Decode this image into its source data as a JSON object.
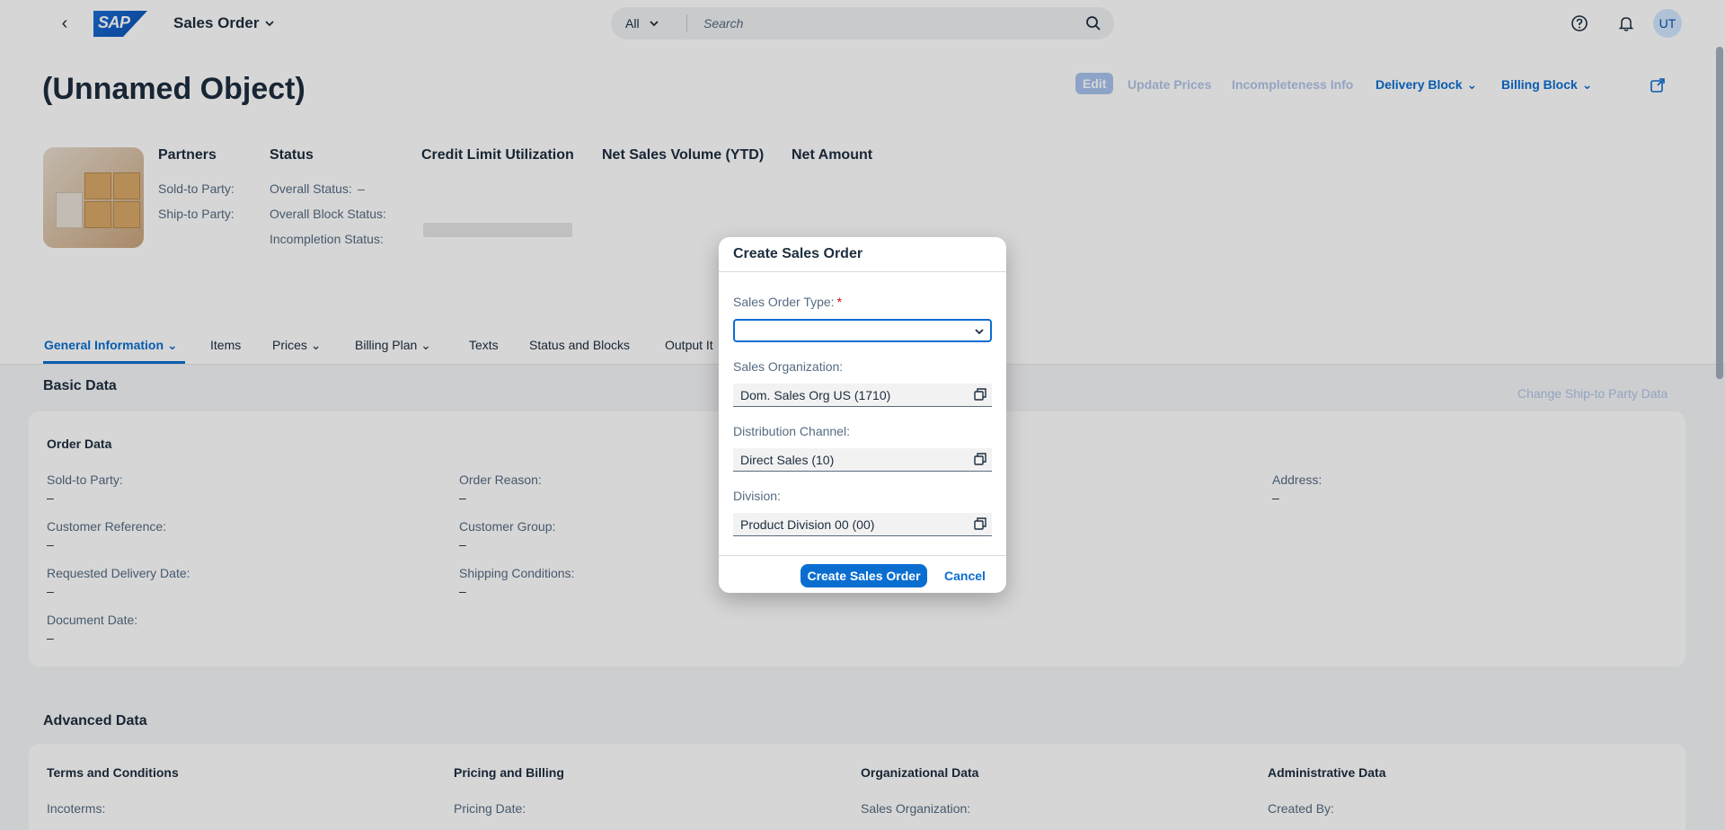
{
  "shell": {
    "app_title": "Sales Order",
    "logo_text": "SAP",
    "search_scope": "All",
    "search_placeholder": "Search",
    "avatar_initials": "UT"
  },
  "object": {
    "title": "(Unnamed Object)",
    "actions": {
      "edit": "Edit",
      "update_prices": "Update Prices",
      "incompleteness_info": "Incompleteness Info",
      "delivery_block": "Delivery Block",
      "billing_block": "Billing Block"
    }
  },
  "header": {
    "partners": {
      "title": "Partners",
      "sold_to": "Sold-to Party:",
      "ship_to": "Ship-to Party:"
    },
    "status": {
      "title": "Status",
      "overall": "Overall Status:",
      "overall_value": "–",
      "block": "Overall Block Status:",
      "incompletion": "Incompletion Status:"
    },
    "credit": "Credit Limit Utilization",
    "net_sales": "Net Sales Volume (YTD)",
    "net_amount": "Net Amount"
  },
  "tabs": [
    "General Information",
    "Items",
    "Prices",
    "Billing Plan",
    "Texts",
    "Status and Blocks",
    "Output It"
  ],
  "basic": {
    "title": "Basic Data",
    "change_link": "Change Ship-to Party Data",
    "order_data": "Order Data",
    "fields": {
      "sold_to": "Sold-to Party:",
      "customer_ref": "Customer Reference:",
      "req_delivery": "Requested Delivery Date:",
      "doc_date": "Document Date:",
      "order_reason": "Order Reason:",
      "customer_group": "Customer Group:",
      "shipping_cond": "Shipping Conditions:",
      "address": "Address:"
    },
    "empty": "–"
  },
  "advanced": {
    "title": "Advanced Data",
    "groups": [
      "Terms and Conditions",
      "Pricing and Billing",
      "Organizational Data",
      "Administrative Data"
    ],
    "fields": [
      "Incoterms:",
      "Pricing Date:",
      "Sales Organization:",
      "Created By:"
    ]
  },
  "dialog": {
    "title": "Create Sales Order",
    "order_type_label": "Sales Order Type:",
    "required_mark": "*",
    "sales_org_label": "Sales Organization:",
    "sales_org_value": "Dom. Sales Org US (1710)",
    "dist_channel_label": "Distribution Channel:",
    "dist_channel_value": "Direct Sales (10)",
    "division_label": "Division:",
    "division_value": "Product Division 00 (00)",
    "create_button": "Create Sales Order",
    "cancel_button": "Cancel"
  }
}
